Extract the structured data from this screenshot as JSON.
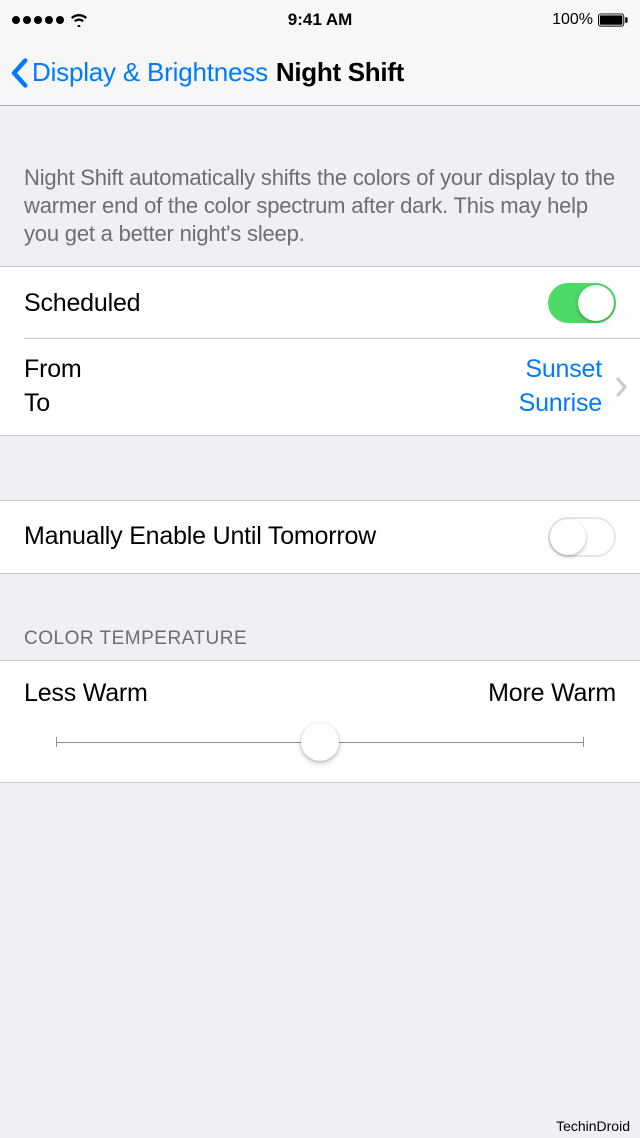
{
  "status": {
    "time": "9:41 AM",
    "battery_percent": "100%"
  },
  "nav": {
    "back_label": "Display & Brightness",
    "title": "Night Shift"
  },
  "description": "Night Shift automatically shifts the colors of your display to the warmer end of the color spectrum after dark. This may help you get a better night's sleep.",
  "scheduled": {
    "label": "Scheduled",
    "enabled": true,
    "from_label": "From",
    "to_label": "To",
    "from_value": "Sunset",
    "to_value": "Sunrise"
  },
  "manual": {
    "label": "Manually Enable Until Tomorrow",
    "enabled": false
  },
  "temperature": {
    "header": "COLOR TEMPERATURE",
    "less_label": "Less Warm",
    "more_label": "More Warm",
    "value_percent": 48
  },
  "watermark": "TechinDroid"
}
